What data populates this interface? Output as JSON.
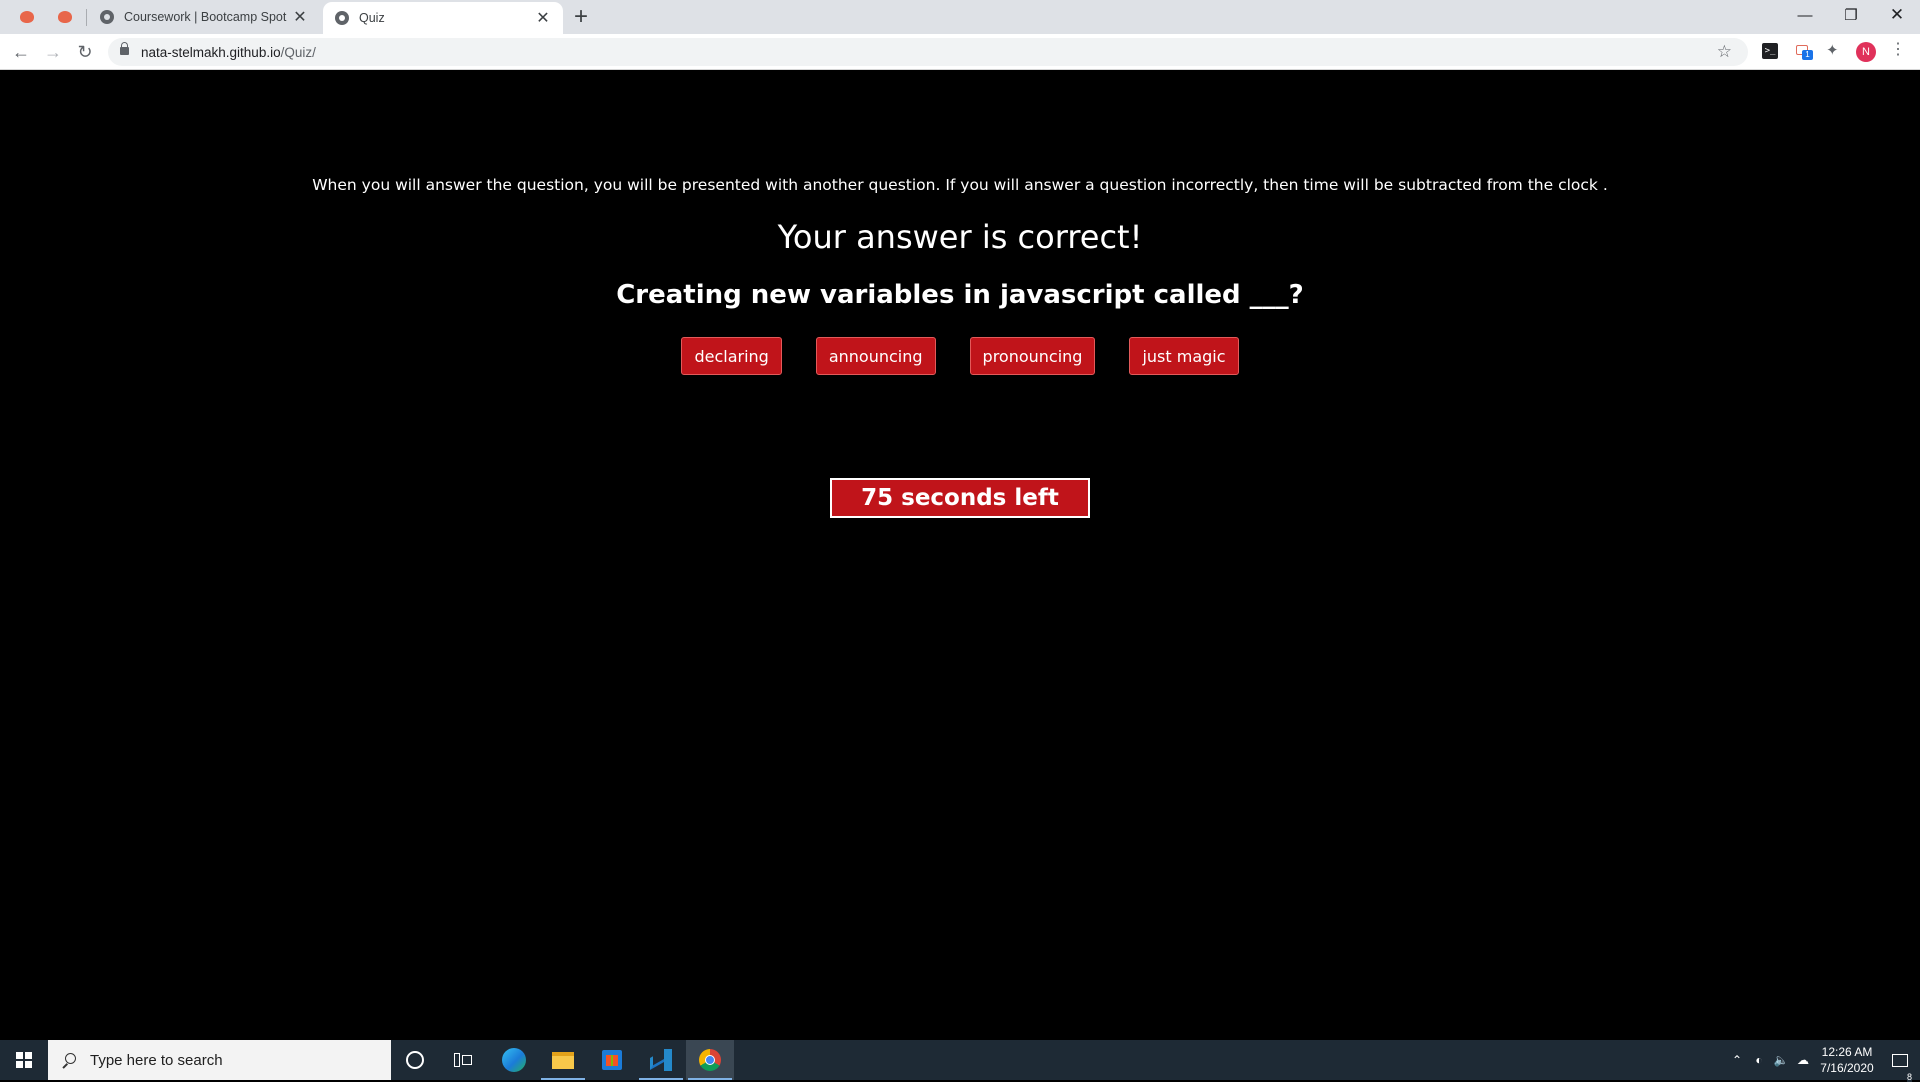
{
  "browser": {
    "tabs": [
      {
        "title": "Coursework | Bootcamp Spot",
        "active": false
      },
      {
        "title": "Quiz",
        "active": true
      }
    ],
    "new_tab_glyph": "+",
    "url_host": "nata-stelmakh.github.io",
    "url_path": "/Quiz/",
    "avatar_initial": "N",
    "extension_badge": "1"
  },
  "page": {
    "instructions": "When you will answer the question, you will be presented with another question. If you will answer a question incorrectly, then time will be subtracted from the clock .",
    "feedback": "Your answer is correct!",
    "question": "Creating new variables in javascript called ___?",
    "answers": [
      "declaring",
      "announcing",
      "pronouncing",
      "just magic"
    ],
    "timer": "75 seconds left"
  },
  "taskbar": {
    "search_placeholder": "Type here to search",
    "time": "12:26 AM",
    "date": "7/16/2020",
    "notification_count": "8"
  },
  "colors": {
    "page_background": "#000000",
    "button_red": "#c0141a",
    "avatar": "#e0315a"
  }
}
